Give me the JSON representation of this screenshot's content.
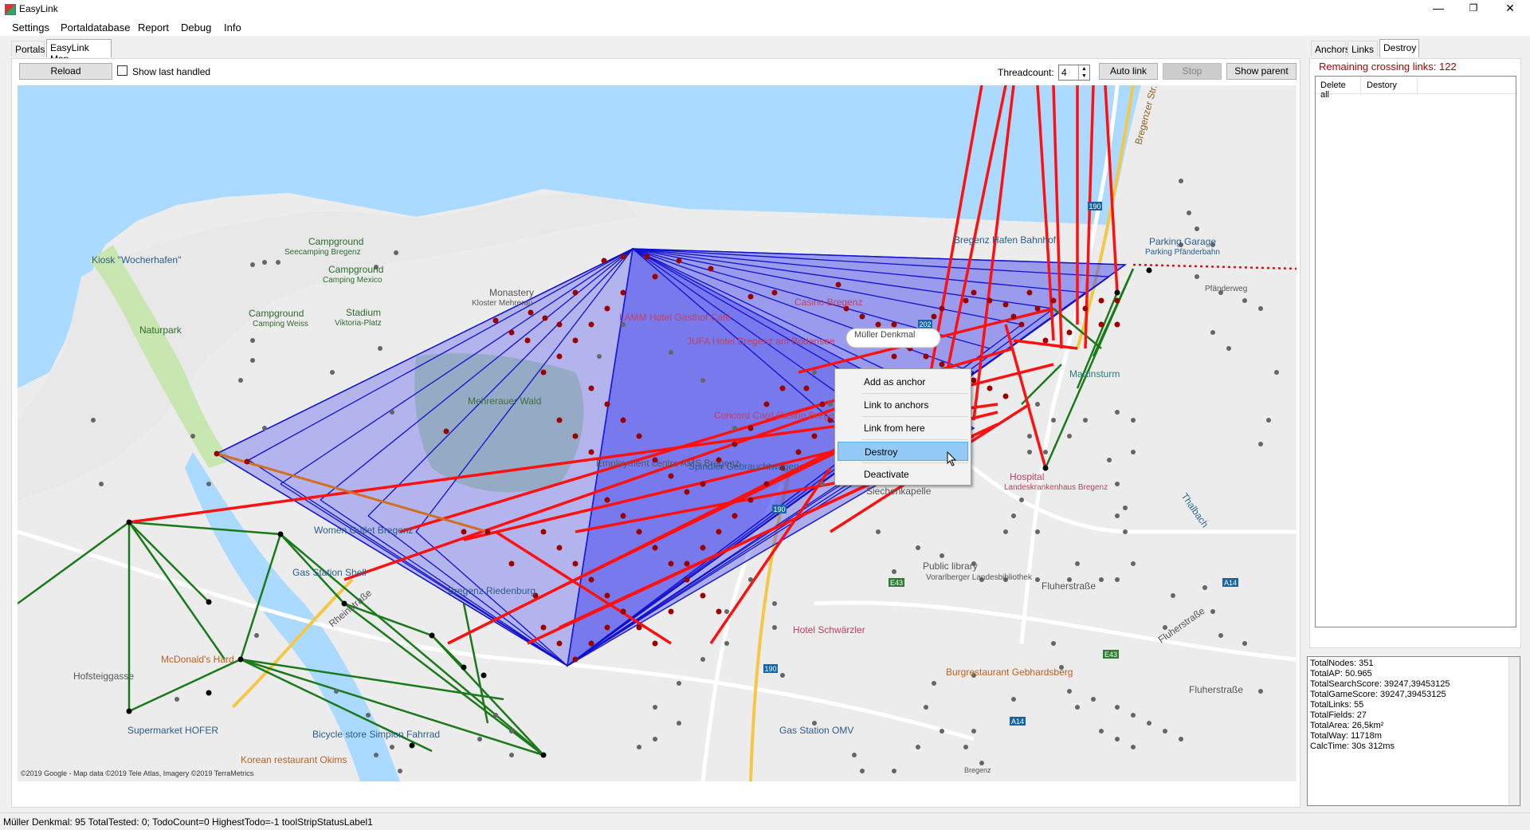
{
  "window": {
    "title": "EasyLink",
    "controls": {
      "minimize": "—",
      "restore": "❐",
      "close": "✕"
    }
  },
  "menu": [
    "Settings",
    "Portaldatabase",
    "Report",
    "Debug",
    "Info"
  ],
  "tabs": {
    "portals": "Portals",
    "map": "EasyLink Map"
  },
  "toolbar": {
    "reload": "Reload",
    "show_last_handled": "Show last handled",
    "threadcount_label": "Threadcount:",
    "threadcount_value": "4",
    "auto_link": "Auto link",
    "stop": "Stop",
    "show_parent": "Show parent"
  },
  "right_tabs": {
    "anchors": "Anchors",
    "links": "Links",
    "destroy": "Destroy"
  },
  "crossing_links": "Remaining crossing links: 122",
  "destroy_list": {
    "delete_all": "Delete all",
    "destroy_col": "Destory"
  },
  "context_menu": {
    "add_anchor": "Add as anchor",
    "link_anchors": "Link to anchors",
    "link_from_here": "Link from here",
    "destroy": "Destroy",
    "deactivate": "Deactivate"
  },
  "map": {
    "tooltip": "Müller Denkmal",
    "copyright": "©2019 Google - Map data ©2019 Tele Atlas, Imagery ©2019 TerraMetrics",
    "labels": {
      "kiosk": "Kiosk \"Wocherhafen\"",
      "naturpark": "Naturpark",
      "campground1": "Campground",
      "seecamping": "Seecamping Bregenz",
      "campground2": "Campground",
      "camping_mexico": "Camping Mexico",
      "campground3": "Campground",
      "camping_weiss": "Camping Weiss",
      "stadium": "Stadium",
      "viktoria_platz": "Viktoria-Platz",
      "monastery": "Monastery",
      "kloster": "Kloster Mehrerau",
      "mehrerau_wald": "Mehrerauer Wald",
      "hotel_lamm": "LAMM Hotel Gasthof Café",
      "casino": "Casino Bregenz",
      "jufa": "JUFA Hotel Bregenz am Bodensee",
      "concord": "Concord Card Casino Bregenz",
      "employment": "Employment centre AMS Bregenz",
      "spindler": "Spindler Gebrauchtwagen",
      "outlet": "Women Outlet Bregenz",
      "gas_shell": "Gas Station Shell",
      "riedenburg": "Bregenz Riedenburg",
      "mcdonalds": "McDonald's Hard",
      "supermarket": "Supermarket HOFER",
      "bicycle": "Bicycle store Simplon Fahrrad",
      "korean": "Korean restaurant Okims",
      "hotel_schwarzler": "Hotel Schwärzler",
      "public_library": "Public library",
      "landesbib": "Vorarlberger Landesbibliothek",
      "burgrestaurant": "Burgrestaurant Gebhardsberg",
      "gas_omv": "Gas Station OMV",
      "siechenkapelle": "Siechenkapelle",
      "hospital": "Hospital",
      "landeskrankenhaus": "Landeskrankenhaus Bregenz",
      "martinsturm": "Martinsturm",
      "parking": "Parking Garage",
      "pfanderbahn": "Parking Pfänderbahn",
      "hafen": "Bregenz Hafen Bahnhof",
      "fluherstr1": "Fluherstraße",
      "fluherstr2": "Fluherstraße",
      "fluherstr3": "Fluherstraße",
      "hofsteig": "Hofsteiggasse",
      "rheinstr": "Rheinstraße",
      "road190a": "190",
      "road190b": "190",
      "road190c": "190",
      "road202": "202",
      "roadE43a": "E43",
      "roadE43b": "E43",
      "roadA14a": "A14",
      "roadA14b": "A14",
      "bregenz_town": "Bregenz",
      "pfanderweg": "Pfänderweg",
      "thalbach": "Thalbach",
      "bregenzer_str": "Bregenzer Str."
    }
  },
  "stats": [
    "TotalNodes: 351",
    "TotalAP: 50.965",
    "TotalSearchScore: 39247,39453125",
    "TotalGameScore: 39247,39453125",
    "TotalLinks: 55",
    "TotalFields: 27",
    "TotalArea: 26,5km²",
    "TotalWay: 11718m",
    "CalcTime: 30s 312ms"
  ],
  "status": "Müller Denkmal: 95  TotalTested: 0; TodoCount=0 HighestTodo=-1  toolStripStatusLabel1",
  "colors": {
    "water": "#aadaff",
    "land": "#ececec",
    "park": "#c8e6b0",
    "field_blue": "#3a3af0",
    "link_red": "#ff0000",
    "link_green": "#1a7a1a",
    "highlight": "#91c9f7"
  }
}
